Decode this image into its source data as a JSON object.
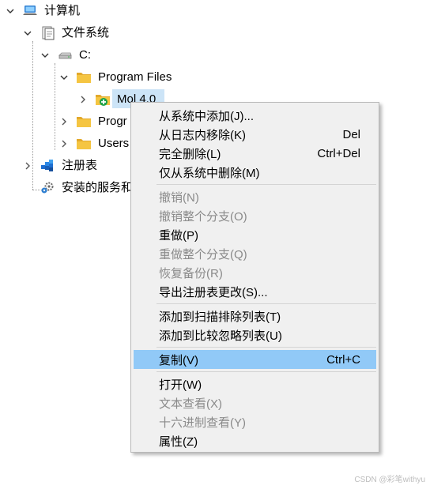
{
  "tree": {
    "root": {
      "label": "计算机",
      "icon": "computer-icon"
    },
    "filesystem": {
      "label": "文件系统",
      "icon": "filesystem-icon"
    },
    "drive_c": {
      "label": "C:",
      "icon": "drive-icon"
    },
    "program_files": {
      "label": "Program Files",
      "icon": "folder-icon"
    },
    "mol": {
      "label": "Mol 4.0",
      "icon": "folder-add-icon"
    },
    "program_x86": {
      "label": "Progr",
      "icon": "folder-icon"
    },
    "users": {
      "label": "Users",
      "icon": "folder-icon"
    },
    "registry": {
      "label": "注册表",
      "icon": "registry-icon"
    },
    "services": {
      "label": "安装的服务和",
      "icon": "services-icon"
    }
  },
  "context_menu": {
    "groups": [
      [
        {
          "label": "从系统中添加(J)...",
          "shortcut": "",
          "enabled": true
        },
        {
          "label": "从日志内移除(K)",
          "shortcut": "Del",
          "enabled": true
        },
        {
          "label": "完全删除(L)",
          "shortcut": "Ctrl+Del",
          "enabled": true
        },
        {
          "label": "仅从系统中删除(M)",
          "shortcut": "",
          "enabled": true
        }
      ],
      [
        {
          "label": "撤销(N)",
          "shortcut": "",
          "enabled": false
        },
        {
          "label": "撤销整个分支(O)",
          "shortcut": "",
          "enabled": false
        },
        {
          "label": "重做(P)",
          "shortcut": "",
          "enabled": true
        },
        {
          "label": "重做整个分支(Q)",
          "shortcut": "",
          "enabled": false
        },
        {
          "label": "恢复备份(R)",
          "shortcut": "",
          "enabled": false
        },
        {
          "label": "导出注册表更改(S)...",
          "shortcut": "",
          "enabled": true
        }
      ],
      [
        {
          "label": "添加到扫描排除列表(T)",
          "shortcut": "",
          "enabled": true
        },
        {
          "label": "添加到比较忽略列表(U)",
          "shortcut": "",
          "enabled": true
        }
      ],
      [
        {
          "label": "复制(V)",
          "shortcut": "Ctrl+C",
          "enabled": true,
          "highlighted": true
        }
      ],
      [
        {
          "label": "打开(W)",
          "shortcut": "",
          "enabled": true
        },
        {
          "label": "文本查看(X)",
          "shortcut": "",
          "enabled": false
        },
        {
          "label": "十六进制查看(Y)",
          "shortcut": "",
          "enabled": false
        },
        {
          "label": "属性(Z)",
          "shortcut": "",
          "enabled": true
        }
      ]
    ]
  },
  "watermark": "CSDN @彩笔withyu",
  "colors": {
    "selection": "#cce4f7",
    "menu_bg": "#f0f0f0",
    "menu_highlight": "#91c9f7",
    "disabled_text": "#8a8a8a",
    "folder": "#f5c542"
  }
}
